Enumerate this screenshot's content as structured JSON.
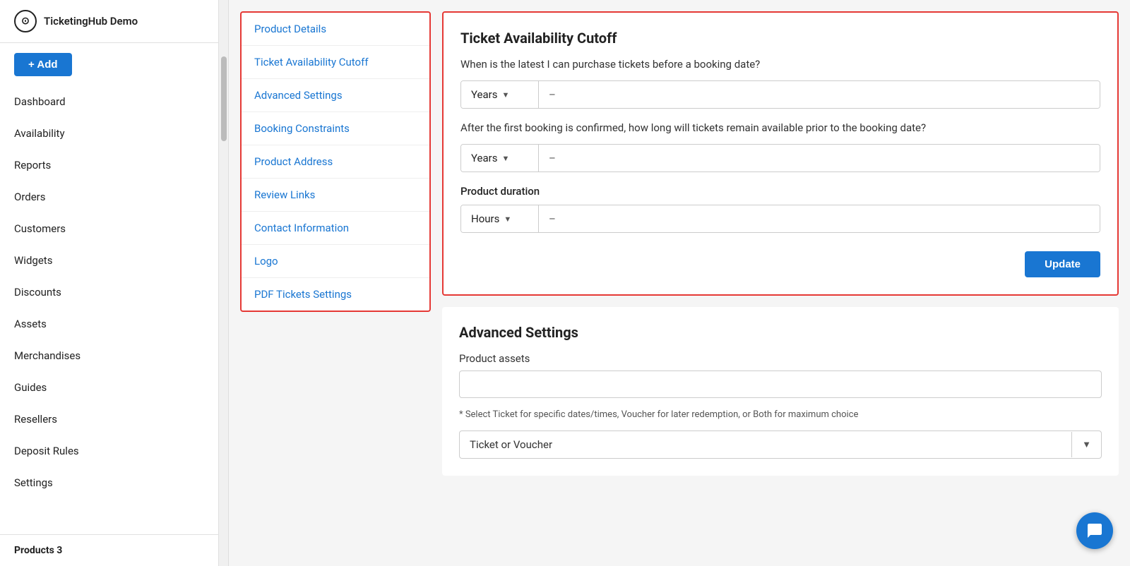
{
  "app": {
    "logo_label": "TicketingHub Demo",
    "add_button": "+ Add"
  },
  "sidebar": {
    "nav_items": [
      {
        "label": "Dashboard"
      },
      {
        "label": "Availability"
      },
      {
        "label": "Reports"
      },
      {
        "label": "Orders"
      },
      {
        "label": "Customers"
      },
      {
        "label": "Widgets"
      },
      {
        "label": "Discounts"
      },
      {
        "label": "Assets"
      },
      {
        "label": "Merchandises"
      },
      {
        "label": "Guides"
      },
      {
        "label": "Resellers"
      },
      {
        "label": "Deposit Rules"
      },
      {
        "label": "Settings"
      }
    ],
    "products_label": "Products 3"
  },
  "nav_panel": {
    "items": [
      {
        "label": "Product Details"
      },
      {
        "label": "Ticket Availability Cutoff"
      },
      {
        "label": "Advanced Settings"
      },
      {
        "label": "Booking Constraints"
      },
      {
        "label": "Product Address"
      },
      {
        "label": "Review Links"
      },
      {
        "label": "Contact Information"
      },
      {
        "label": "Logo"
      },
      {
        "label": "PDF Tickets Settings"
      }
    ]
  },
  "ticket_cutoff": {
    "title": "Ticket Availability Cutoff",
    "question1": "When is the latest I can purchase tickets before a booking date?",
    "dropdown1_value": "Years",
    "value1": "–",
    "question2": "After the first booking is confirmed, how long will tickets remain available prior to the booking date?",
    "dropdown2_value": "Years",
    "value2": "–",
    "duration_label": "Product duration",
    "dropdown3_value": "Hours",
    "value3": "–",
    "update_button": "Update"
  },
  "advanced_settings": {
    "title": "Advanced Settings",
    "assets_label": "Product assets",
    "assets_value": "",
    "note": "* Select Ticket for specific dates/times, Voucher for later redemption, or Both for maximum choice",
    "dropdown_value": "Ticket or Voucher"
  }
}
